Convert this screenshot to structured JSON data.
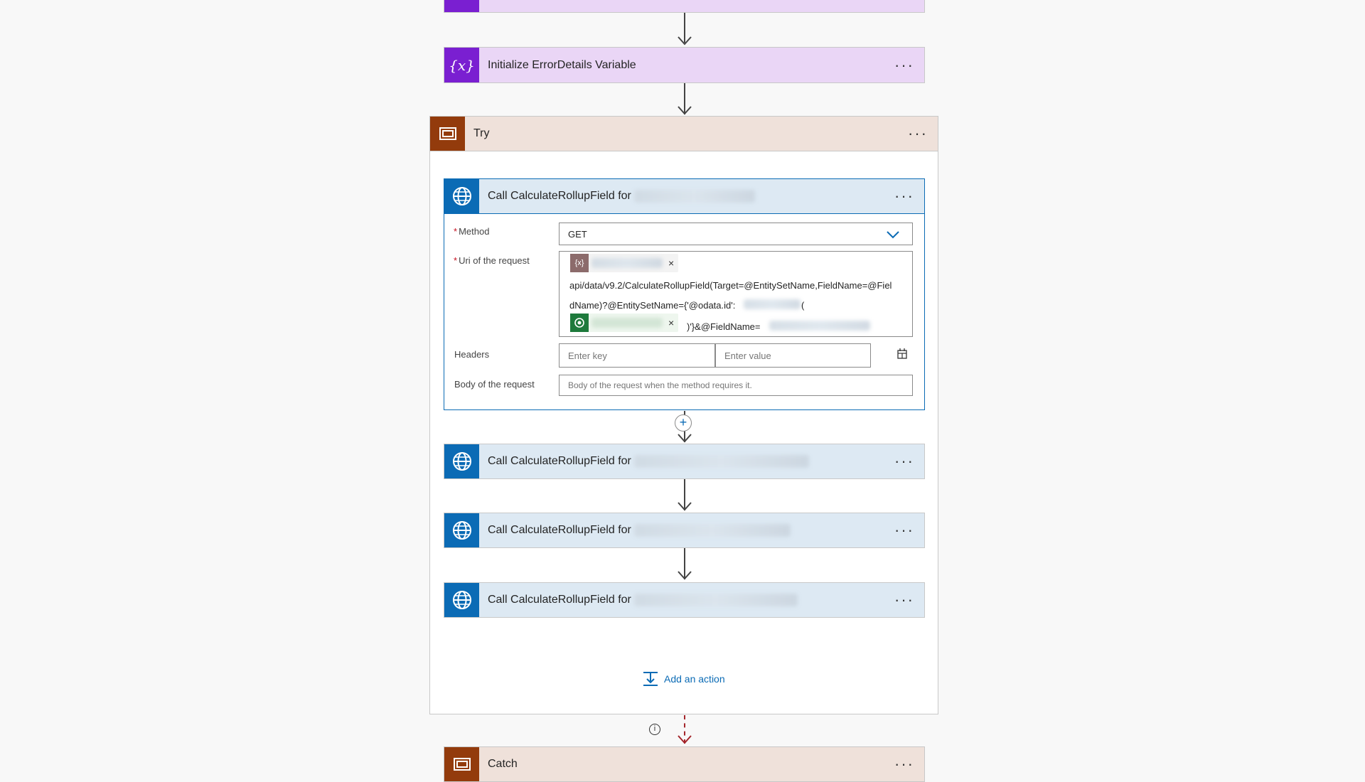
{
  "top_card": {},
  "init_variable": {
    "title": "Initialize ErrorDetails Variable",
    "icon": "variable-icon"
  },
  "try_scope": {
    "title": "Try",
    "expanded_action": {
      "title": "Call CalculateRollupField for",
      "method_label": "Method",
      "method_value": "GET",
      "url_label": "Uri of the request",
      "url_line1": "api/data/v9.2/CalculateRollupField(Target=@EntitySetName,FieldName=@Fiel",
      "url_line2": "dName)?@EntitySetName={'@odata.id':",
      "url_line2_tail": "(",
      "url_line3": ")'}&@FieldName=",
      "headers_label": "Headers",
      "header_key_placeholder": "Enter key",
      "header_value_placeholder": "Enter value",
      "body_label": "Body of the request",
      "body_placeholder": "Body of the request when the method requires it."
    },
    "actions": [
      {
        "title": "Call CalculateRollupField for"
      },
      {
        "title": "Call CalculateRollupField for"
      },
      {
        "title": "Call CalculateRollupField for"
      }
    ],
    "add_action_label": "Add an action"
  },
  "catch_scope": {
    "title": "Catch"
  },
  "colors": {
    "http_icon": "#0b6bb5",
    "variable_icon": "#7a1fd1",
    "scope_icon": "#933b0c",
    "run_after_failed": "#a4262c"
  }
}
